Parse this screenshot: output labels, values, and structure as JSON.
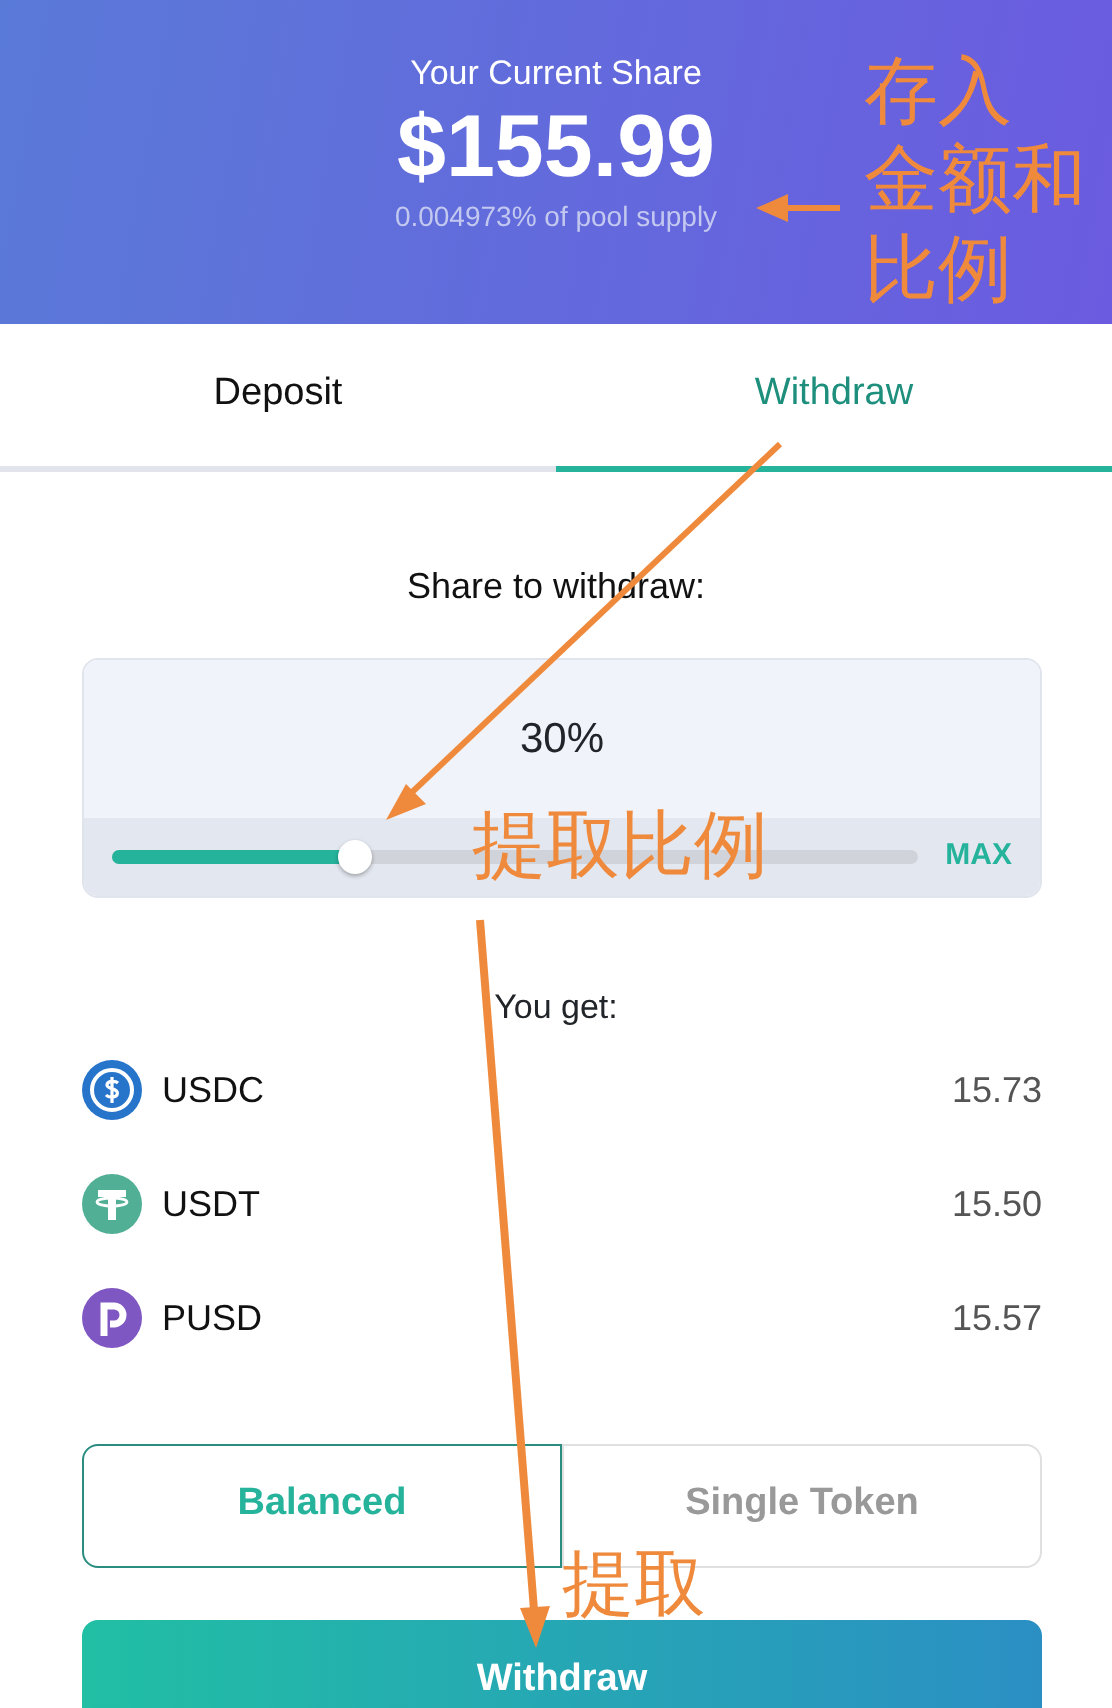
{
  "header": {
    "title": "Your Current Share",
    "amount": "$155.99",
    "subtitle": "0.004973% of pool supply"
  },
  "tabs": [
    {
      "label": "Deposit",
      "selected": false
    },
    {
      "label": "Withdraw",
      "selected": true
    }
  ],
  "share": {
    "label": "Share to withdraw:",
    "value": "30%",
    "level": 0.3,
    "max_label": "MAX"
  },
  "you_get": {
    "label": "You get:",
    "tokens": [
      {
        "symbol": "USDC",
        "amount": "15.73",
        "color": "#2775ca",
        "kind": "usdc"
      },
      {
        "symbol": "USDT",
        "amount": "15.50",
        "color": "#50af95",
        "kind": "usdt"
      },
      {
        "symbol": "PUSD",
        "amount": "15.57",
        "color": "#7e57c2",
        "kind": "pusd"
      }
    ]
  },
  "modes": [
    {
      "label": "Balanced",
      "selected": true
    },
    {
      "label": "Single Token",
      "selected": false
    }
  ],
  "submit": {
    "label": "Withdraw"
  },
  "annotations": [
    {
      "lines": [
        "存入",
        "金额和",
        "比例"
      ],
      "kind": "amount"
    },
    {
      "text": "提取比例",
      "kind": "slider"
    },
    {
      "text": "提取",
      "kind": "button"
    }
  ]
}
